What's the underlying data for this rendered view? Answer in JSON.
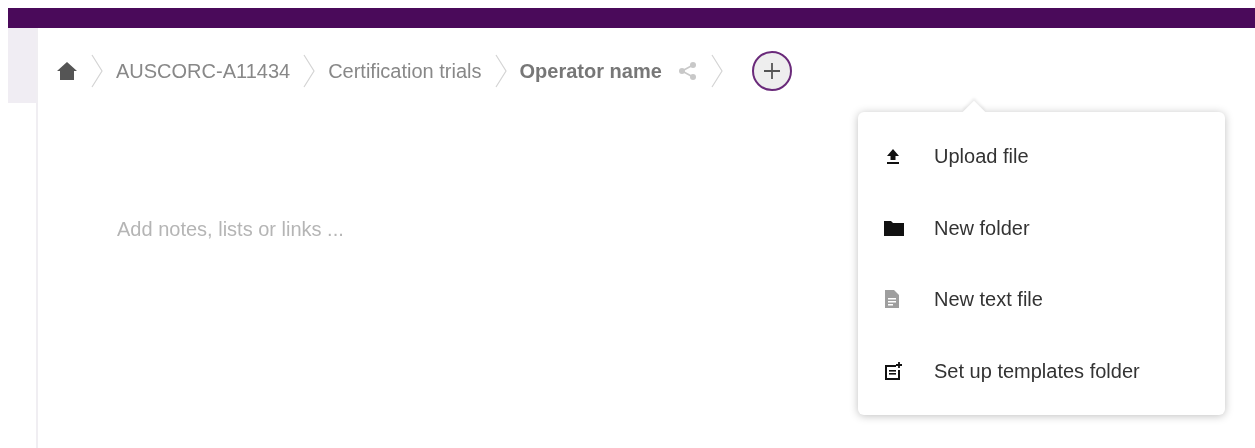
{
  "breadcrumb": [
    {
      "label": "AUSCORC-A11434",
      "current": false
    },
    {
      "label": "Certification trials",
      "current": false
    },
    {
      "label": "Operator name",
      "current": true
    }
  ],
  "editor": {
    "placeholder": "Add notes, lists or links ..."
  },
  "new_menu": {
    "expanded": true,
    "items": [
      {
        "kind": "upload",
        "label": "Upload file"
      },
      {
        "kind": "folder",
        "label": "New folder"
      },
      {
        "kind": "text",
        "label": "New text file"
      },
      {
        "kind": "templates",
        "label": "Set up templates folder"
      }
    ]
  }
}
